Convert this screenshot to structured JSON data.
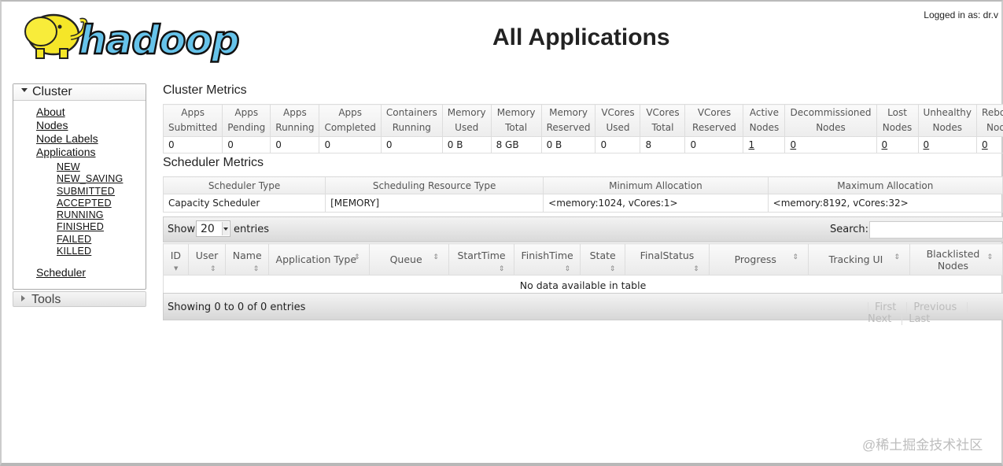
{
  "header": {
    "logged_in": "Logged in as: dr.v",
    "title": "All Applications",
    "logo_text": "hadoop"
  },
  "sidebar": {
    "cluster_label": "Cluster",
    "links": [
      "About",
      "Nodes",
      "Node Labels",
      "Applications"
    ],
    "states": [
      "NEW",
      "NEW_SAVING",
      "SUBMITTED",
      "ACCEPTED",
      "RUNNING",
      "FINISHED",
      "FAILED",
      "KILLED"
    ],
    "scheduler": "Scheduler",
    "tools_label": "Tools"
  },
  "cluster_metrics": {
    "title": "Cluster Metrics",
    "headers": [
      [
        "Apps",
        "Submitted"
      ],
      [
        "Apps",
        "Pending"
      ],
      [
        "Apps",
        "Running"
      ],
      [
        "Apps",
        "Completed"
      ],
      [
        "Containers",
        "Running"
      ],
      [
        "Memory",
        "Used"
      ],
      [
        "Memory",
        "Total"
      ],
      [
        "Memory",
        "Reserved"
      ],
      [
        "VCores",
        "Used"
      ],
      [
        "VCores",
        "Total"
      ],
      [
        "VCores",
        "Reserved"
      ],
      [
        "Active",
        "Nodes"
      ],
      [
        "Decommissioned",
        "Nodes"
      ],
      [
        "Lost",
        "Nodes"
      ],
      [
        "Unhealthy",
        "Nodes"
      ],
      [
        "Reboote",
        "Nodes"
      ]
    ],
    "values": [
      "0",
      "0",
      "0",
      "0",
      "0",
      "0 B",
      "8 GB",
      "0 B",
      "0",
      "8",
      "0",
      "1",
      "0",
      "0",
      "0",
      "0"
    ]
  },
  "scheduler_metrics": {
    "title": "Scheduler Metrics",
    "headers": [
      "Scheduler Type",
      "Scheduling Resource Type",
      "Minimum Allocation",
      "Maximum Allocation"
    ],
    "values": [
      "Capacity Scheduler",
      "[MEMORY]",
      "<memory:1024, vCores:1>",
      "<memory:8192, vCores:32>"
    ]
  },
  "apps_table": {
    "show_label": "Show",
    "page_size": "20",
    "entries_label": "entries",
    "search_label": "Search:",
    "columns": [
      "ID",
      "User",
      "Name",
      "Application Type",
      "Queue",
      "StartTime",
      "FinishTime",
      "State",
      "FinalStatus",
      "Progress",
      "Tracking UI",
      "Blacklisted Nodes"
    ],
    "empty_message": "No data available in table",
    "info": "Showing 0 to 0 of 0 entries",
    "pager": [
      "First",
      "Previous",
      "Next",
      "Last"
    ]
  },
  "watermark": "@稀土掘金技术社区"
}
